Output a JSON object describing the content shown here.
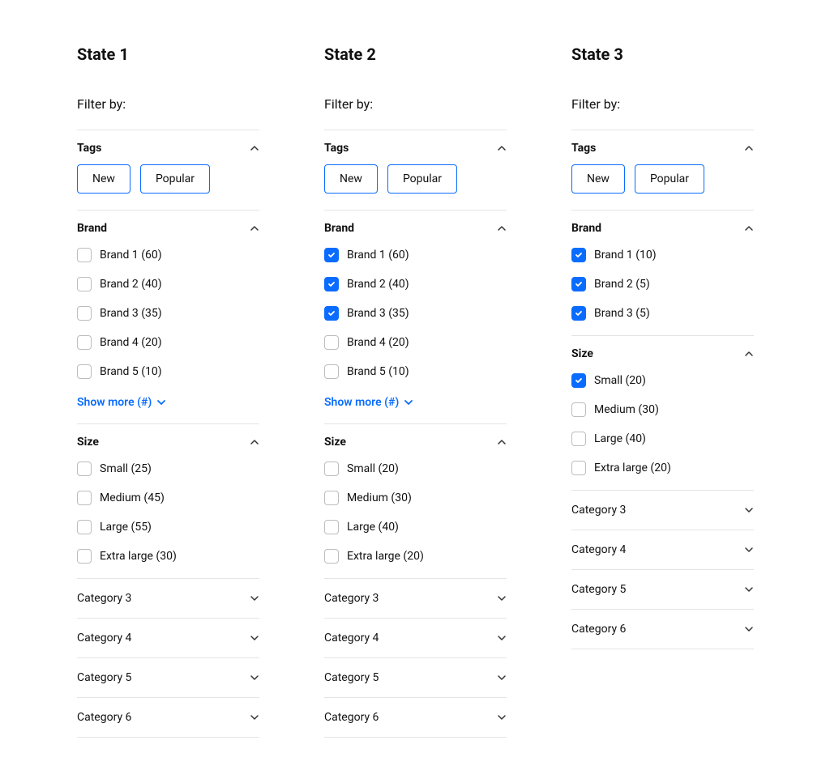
{
  "accent": "#0a6cff",
  "states": [
    {
      "title": "State 1",
      "filter_by": "Filter by:",
      "tags_title": "Tags",
      "tags": [
        "New",
        "Popular"
      ],
      "brand_title": "Brand",
      "brand_items": [
        {
          "label": "Brand 1 (60)",
          "checked": false
        },
        {
          "label": "Brand 2 (40)",
          "checked": false
        },
        {
          "label": "Brand 3 (35)",
          "checked": false
        },
        {
          "label": "Brand 4 (20)",
          "checked": false
        },
        {
          "label": "Brand 5 (10)",
          "checked": false
        }
      ],
      "show_more": "Show more (#)",
      "size_title": "Size",
      "size_items": [
        {
          "label": "Small (25)",
          "checked": false
        },
        {
          "label": "Medium (45)",
          "checked": false
        },
        {
          "label": "Large (55)",
          "checked": false
        },
        {
          "label": "Extra large (30)",
          "checked": false
        }
      ],
      "collapsed": [
        "Category 3",
        "Category 4",
        "Category 5",
        "Category 6"
      ]
    },
    {
      "title": "State 2",
      "filter_by": "Filter by:",
      "tags_title": "Tags",
      "tags": [
        "New",
        "Popular"
      ],
      "brand_title": "Brand",
      "brand_items": [
        {
          "label": "Brand 1 (60)",
          "checked": true
        },
        {
          "label": "Brand 2 (40)",
          "checked": true
        },
        {
          "label": "Brand 3 (35)",
          "checked": true
        },
        {
          "label": "Brand 4 (20)",
          "checked": false
        },
        {
          "label": "Brand 5 (10)",
          "checked": false
        }
      ],
      "show_more": "Show more (#)",
      "size_title": "Size",
      "size_items": [
        {
          "label": "Small (20)",
          "checked": false
        },
        {
          "label": "Medium (30)",
          "checked": false
        },
        {
          "label": "Large (40)",
          "checked": false
        },
        {
          "label": "Extra large (20)",
          "checked": false
        }
      ],
      "collapsed": [
        "Category 3",
        "Category 4",
        "Category 5",
        "Category 6"
      ]
    },
    {
      "title": "State 3",
      "filter_by": "Filter by:",
      "tags_title": "Tags",
      "tags": [
        "New",
        "Popular"
      ],
      "brand_title": "Brand",
      "brand_items": [
        {
          "label": "Brand 1 (10)",
          "checked": true
        },
        {
          "label": "Brand 2 (5)",
          "checked": true
        },
        {
          "label": "Brand 3 (5)",
          "checked": true
        }
      ],
      "show_more": null,
      "size_title": "Size",
      "size_items": [
        {
          "label": "Small (20)",
          "checked": true
        },
        {
          "label": "Medium (30)",
          "checked": false
        },
        {
          "label": "Large (40)",
          "checked": false
        },
        {
          "label": "Extra large (20)",
          "checked": false
        }
      ],
      "collapsed": [
        "Category 3",
        "Category 4",
        "Category 5",
        "Category 6"
      ]
    }
  ]
}
